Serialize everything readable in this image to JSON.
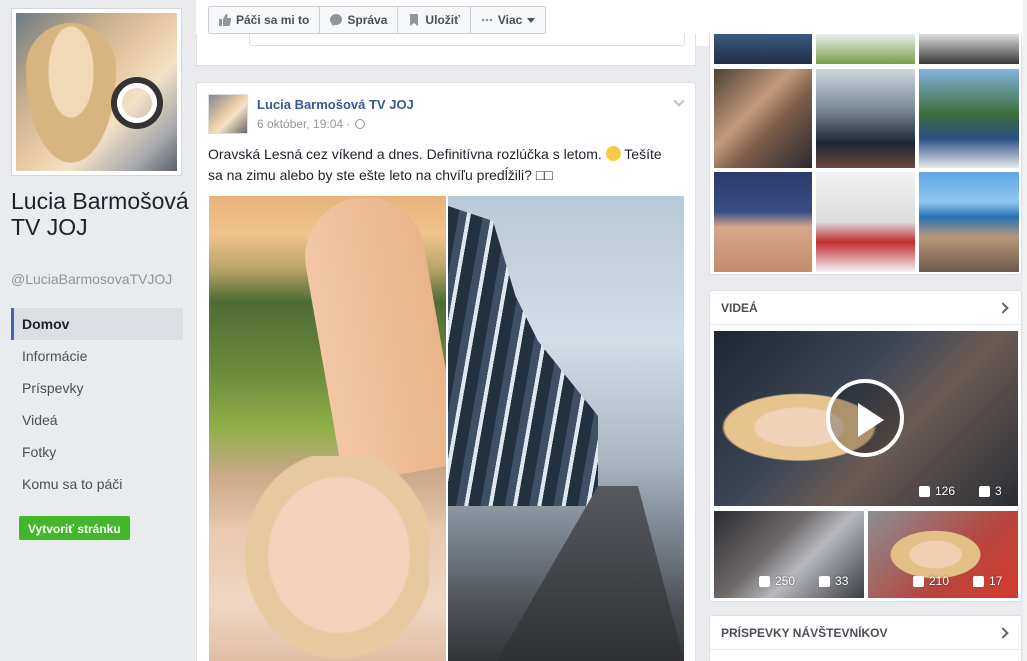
{
  "page": {
    "name": "Lucia Barmošová TV JOJ",
    "handle": "@LuciaBarmosovaTVJOJ"
  },
  "nav": {
    "items": [
      {
        "label": "Domov",
        "active": true
      },
      {
        "label": "Informácie"
      },
      {
        "label": "Príspevky"
      },
      {
        "label": "Videá"
      },
      {
        "label": "Fotky"
      },
      {
        "label": "Komu sa to páči"
      }
    ],
    "create_page": "Vytvoriť stránku"
  },
  "actions": {
    "like": "Páči sa mi to",
    "message": "Správa",
    "save": "Uložiť",
    "more": "Viac"
  },
  "post": {
    "author": "Lucia Barmošová TV JOJ",
    "timestamp": "6 október, 19:04 ·",
    "text_part1": "Oravská Lesná cez víkend a dnes. Definitívna rozlúčka s letom.",
    "text_part2": "Tešíte sa na zimu alebo by ste ešte leto na chvíľu predĺžili? □□"
  },
  "videos": {
    "header": "VIDEÁ",
    "main": {
      "likes": "126",
      "comments": "3"
    },
    "small": [
      {
        "likes": "250",
        "comments": "33"
      },
      {
        "likes": "210",
        "comments": "17"
      }
    ]
  },
  "visitors": {
    "header": "PRÍSPEVKY NÁVŠTEVNÍKOV"
  },
  "colors": {
    "link": "#365899",
    "accent": "#4267b2",
    "create_button": "#42b72a",
    "background": "#e9ebee"
  }
}
